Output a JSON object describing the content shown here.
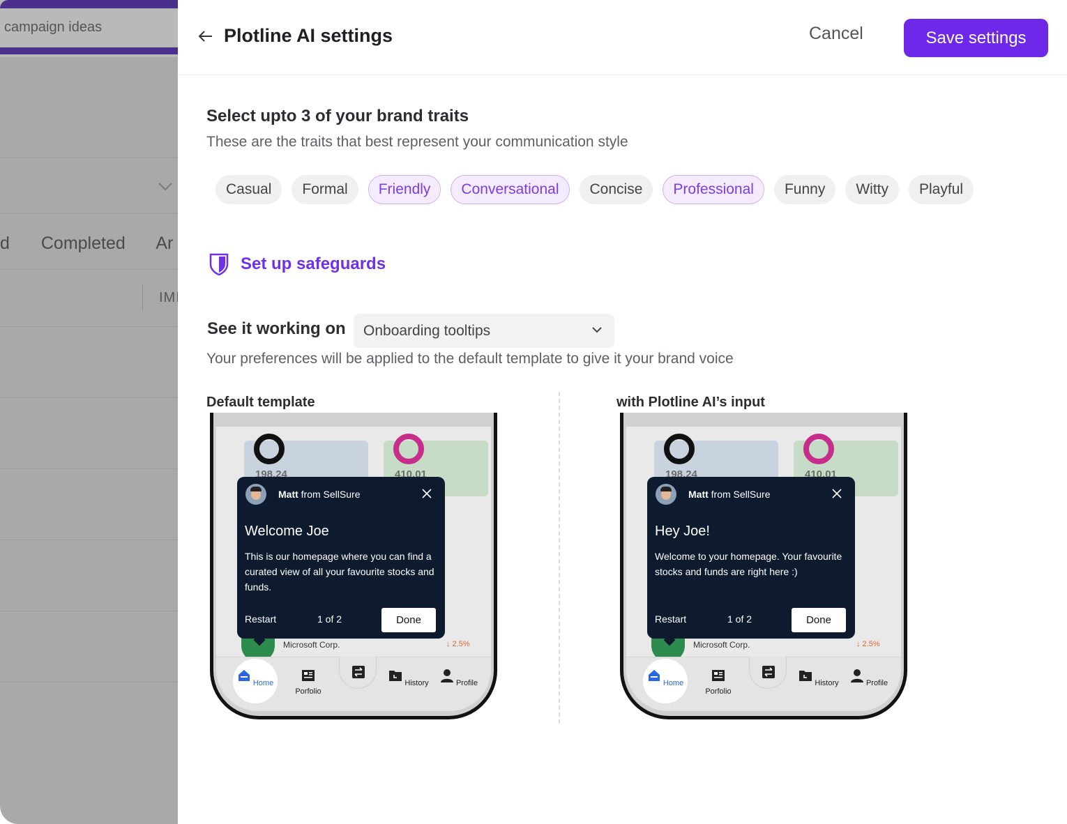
{
  "background": {
    "search_text": "campaign ideas",
    "tabs": [
      "d",
      "Completed",
      "Ar"
    ],
    "column_header": "IMI"
  },
  "header": {
    "title": "Plotline AI settings",
    "cancel_label": "Cancel",
    "save_label": "Save settings"
  },
  "traits": {
    "title": "Select upto 3 of your brand traits",
    "subtitle": "These are the traits that best represent your communication style",
    "items": [
      {
        "label": "Casual",
        "selected": false
      },
      {
        "label": "Formal",
        "selected": false
      },
      {
        "label": "Friendly",
        "selected": true
      },
      {
        "label": "Conversational",
        "selected": true
      },
      {
        "label": "Concise",
        "selected": false
      },
      {
        "label": "Professional",
        "selected": true
      },
      {
        "label": "Funny",
        "selected": false
      },
      {
        "label": "Witty",
        "selected": false
      },
      {
        "label": "Playful",
        "selected": false
      }
    ]
  },
  "safeguards": {
    "label": "Set up safeguards",
    "icon": "shield-icon"
  },
  "preview": {
    "see_label": "See it working on",
    "dropdown_value": "Onboarding tooltips",
    "subtitle": "Your preferences will be applied to the default template to give it your brand voice",
    "default_label": "Default template",
    "ai_label": "with Plotline AI’s input",
    "default_tooltip": {
      "sender_name": "Matt",
      "sender_from": "from SellSure",
      "title": "Welcome Joe",
      "body": "This is our homepage where you can find a curated view of all your favourite stocks and funds.",
      "restart": "Restart",
      "count": "1 of 2",
      "done": "Done"
    },
    "ai_tooltip": {
      "sender_name": "Matt",
      "sender_from": "from SellSure",
      "title": "Hey Joe!",
      "body": "Welcome to your homepage. Your favourite stocks and funds are right here :)",
      "restart": "Restart",
      "count": "1 of 2",
      "done": "Done"
    },
    "phone": {
      "card1_value": "198.24",
      "card2_value": "410.01",
      "stock_name": "Microsoft Corp.",
      "stock_change": "↓ 2.5%",
      "nav": [
        "Home",
        "Porfolio",
        "History",
        "Profile"
      ]
    }
  },
  "colors": {
    "accent": "#6d28e9",
    "chip_selected_bg": "#f4ebff",
    "chip_selected_text": "#7a3ee6",
    "tooltip_bg": "#0e1a2e"
  }
}
